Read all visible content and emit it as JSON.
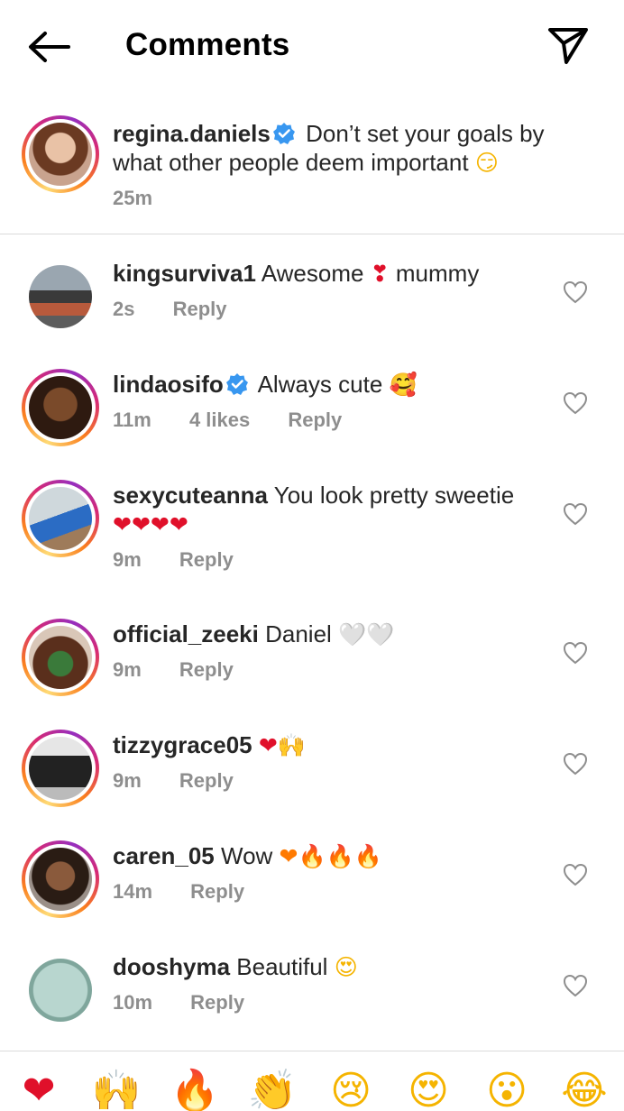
{
  "header": {
    "title": "Comments",
    "back_icon": "arrow-left-icon",
    "send_icon": "paper-plane-icon"
  },
  "caption": {
    "username": "regina.daniels",
    "verified": true,
    "text": "Don’t set your goals by what other people deem important",
    "emoji": "😏",
    "time": "25m"
  },
  "comments": [
    {
      "username": "kingsurviva1",
      "verified": false,
      "text": "Awesome",
      "emoji": "❣",
      "text2": "mummy",
      "time": "2s",
      "likes": "",
      "reply": "Reply"
    },
    {
      "username": "lindaosifo",
      "verified": true,
      "text": "Always cute",
      "emoji": "🥰",
      "time": "11m",
      "likes": "4 likes",
      "reply": "Reply"
    },
    {
      "username": "sexycuteanna",
      "verified": false,
      "text": "You look pretty sweetie",
      "emoji": "❤❤❤❤",
      "time": "9m",
      "likes": "",
      "reply": "Reply"
    },
    {
      "username": "official_zeeki",
      "verified": false,
      "text": "Daniel",
      "emoji": "🤍🤍",
      "time": "9m",
      "likes": "",
      "reply": "Reply"
    },
    {
      "username": "tizzygrace05",
      "verified": false,
      "text": "",
      "emoji": "❤🙌",
      "time": "9m",
      "likes": "",
      "reply": "Reply"
    },
    {
      "username": "caren_05",
      "verified": false,
      "text": "Wow",
      "emoji": "❤🔥🔥🔥",
      "time": "14m",
      "likes": "",
      "reply": "Reply"
    },
    {
      "username": "dooshyma",
      "verified": false,
      "text": "Beautiful",
      "emoji": "😍",
      "time": "10m",
      "likes": "",
      "reply": "Reply"
    }
  ],
  "reactions": [
    "❤",
    "🙌",
    "🔥",
    "👏",
    "😢",
    "😍",
    "😮",
    "😂"
  ],
  "colors": {
    "text": "#262626",
    "muted": "#8e8e8e",
    "verified": "#3897f0",
    "divider": "#dbdbdb"
  }
}
